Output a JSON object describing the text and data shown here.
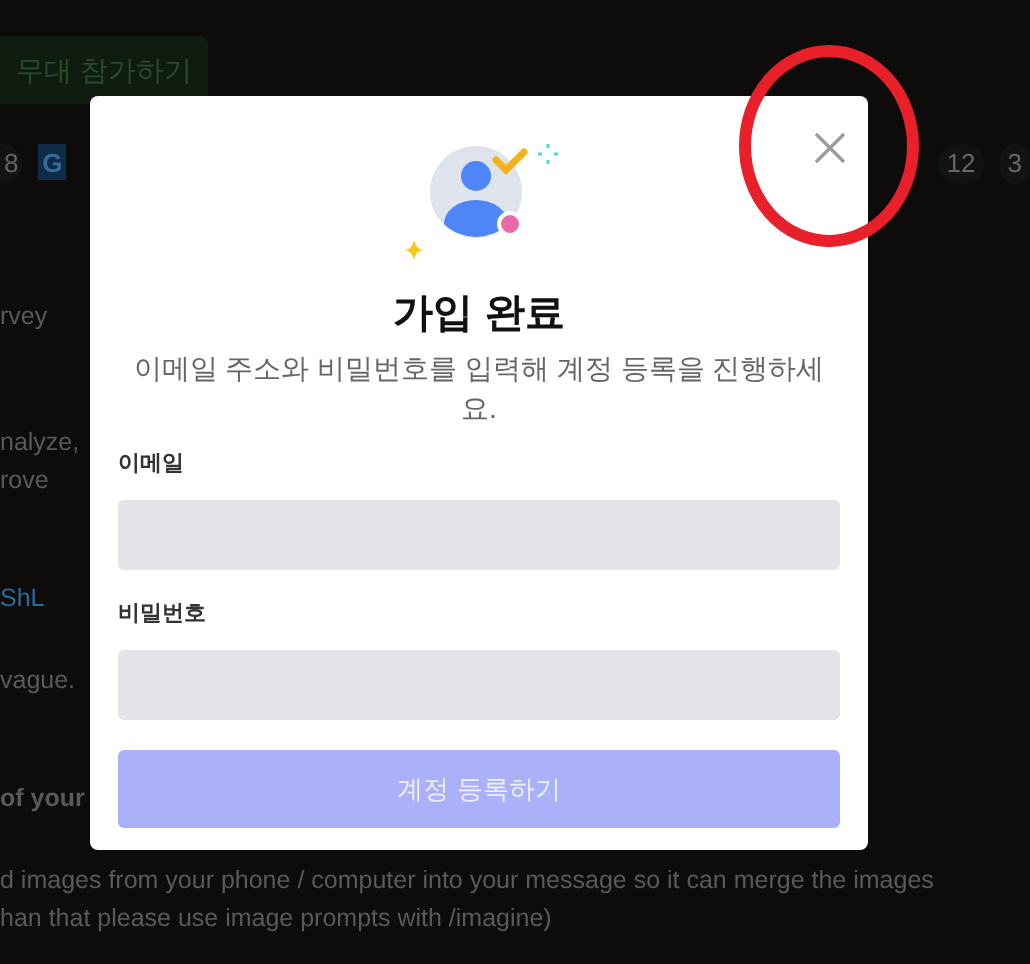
{
  "background": {
    "join_button": "무대 참가하기",
    "chips": [
      {
        "kind": "text",
        "label": "8"
      },
      {
        "kind": "logo",
        "label": "G"
      },
      {
        "kind": "text",
        "label": "12"
      },
      {
        "kind": "text",
        "label": "3"
      }
    ],
    "lines": [
      {
        "kind": "plain",
        "text": "rvey"
      },
      {
        "kind": "plain",
        "text": "nalyze,"
      },
      {
        "kind": "plain",
        "text": "rove"
      },
      {
        "kind": "link",
        "text": "ShL"
      },
      {
        "kind": "plain",
        "text": "vague."
      },
      {
        "kind": "bold",
        "text": "of your"
      },
      {
        "kind": "plain",
        "text": "d images from your phone / computer into your message so it can merge the images"
      },
      {
        "kind": "plain",
        "text": "han that please use image prompts with /imagine)"
      }
    ]
  },
  "modal": {
    "title": "가입 완료",
    "subtitle": "이메일 주소와 비밀번호를 입력해 계정 등록을 진행하세요.",
    "fields": [
      {
        "label": "이메일"
      },
      {
        "label": "비밀번호"
      }
    ],
    "submit": {
      "label": "계정 등록하기",
      "disabled": true
    }
  }
}
